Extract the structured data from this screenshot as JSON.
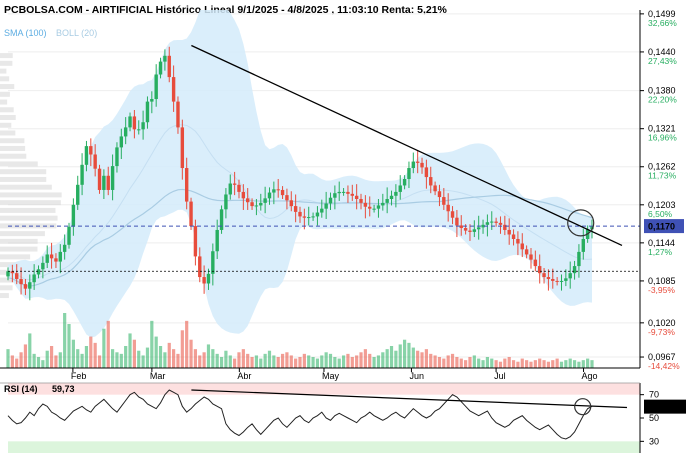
{
  "header": {
    "title": "PCBOLSA.COM - AIRTIFICIAL Histórico Lineal 9/1/2025 - 4/8/2025 , 11:03:10 Renta: 5,21%",
    "indicators": {
      "sma_label": "SMA (100)",
      "boll_label": "BOLL (20)"
    }
  },
  "colors": {
    "up": "#27ae60",
    "down": "#e74c3c",
    "bollinger_fill": "#d4ebfa",
    "sma": "#a9cce3",
    "current_price_line": "#3f51b5",
    "price_badge": "#3f51b5",
    "rsi_overbought_band": "#fde0e0",
    "rsi_oversold_band": "#dcf5dc"
  },
  "chart_data": {
    "type": "candlestick",
    "x_labels": [
      "Feb",
      "Mar",
      "Abr",
      "May",
      "Jun",
      "Jul",
      "Ago"
    ],
    "y_ticks": [
      "0,1499",
      "0,1440",
      "0,1380",
      "0,1321",
      "0,1262",
      "0,1203",
      "0,1144",
      "0,1085",
      "0,1020",
      "0,0967"
    ],
    "pct_ticks": [
      "32,66%",
      "27,43%",
      "22,20%",
      "16,96%",
      "11,73%",
      "6,50%",
      "1,27%",
      "-3,95%",
      "-9,73%",
      "-14,42%"
    ],
    "current_price": "0,1170",
    "reference_price": 0.11,
    "ylim": [
      0.095,
      0.1505
    ],
    "date_range": [
      "2025-01-09",
      "2025-08-04"
    ],
    "trendline": {
      "from": [
        "2025-03-15",
        0.145
      ],
      "to": [
        "2025-08-04",
        0.115
      ]
    },
    "highlight_circle_at": [
      "2025-07-31",
      0.1175
    ],
    "rsi": {
      "label": "RSI (14)",
      "value": "59,73",
      "value_badge": "59,736",
      "levels": [
        "70",
        "50",
        "30"
      ],
      "ylim": [
        20,
        80
      ],
      "trendline": {
        "from": [
          "2025-03-15",
          74
        ],
        "to": [
          "2025-08-04",
          60
        ]
      },
      "values": [
        52,
        48,
        45,
        46,
        50,
        55,
        52,
        58,
        62,
        60,
        55,
        53,
        50,
        48,
        52,
        56,
        58,
        60,
        57,
        55,
        60,
        63,
        66,
        62,
        58,
        55,
        60,
        65,
        70,
        72,
        68,
        66,
        62,
        60,
        58,
        63,
        70,
        74,
        72,
        70,
        60,
        55,
        58,
        62,
        65,
        68,
        66,
        62,
        60,
        58,
        45,
        40,
        37,
        35,
        38,
        42,
        45,
        40,
        36,
        40,
        44,
        48,
        50,
        45,
        42,
        46,
        50,
        52,
        48,
        46,
        50,
        52,
        55,
        50,
        48,
        52,
        54,
        52,
        50,
        48,
        46,
        50,
        52,
        55,
        52,
        50,
        48,
        50,
        53,
        55,
        52,
        50,
        54,
        58,
        55,
        52,
        50,
        52,
        56,
        58,
        62,
        66,
        70,
        68,
        64,
        60,
        56,
        54,
        52,
        54,
        56,
        50,
        46,
        44,
        42,
        44,
        48,
        50,
        52,
        48,
        45,
        42,
        40,
        42,
        44,
        40,
        36,
        33,
        32,
        34,
        38,
        45,
        52,
        58,
        60
      ]
    },
    "series": {
      "open": [
        0.1092,
        0.11,
        0.1097,
        0.1088,
        0.108,
        0.1073,
        0.1083,
        0.1095,
        0.1103,
        0.1113,
        0.1126,
        0.112,
        0.1115,
        0.113,
        0.1141,
        0.1169,
        0.1203,
        0.1234,
        0.1265,
        0.1294,
        0.1281,
        0.1259,
        0.1226,
        0.1248,
        0.1226,
        0.1263,
        0.1292,
        0.1309,
        0.1323,
        0.134,
        0.132,
        0.132,
        0.1331,
        0.1363,
        0.1367,
        0.1405,
        0.1425,
        0.1434,
        0.1401,
        0.1363,
        0.1323,
        0.126,
        0.1208,
        0.117,
        0.1123,
        0.1091,
        0.1081,
        0.1096,
        0.1131,
        0.1164,
        0.1196,
        0.1219,
        0.1236,
        0.1234,
        0.1223,
        0.1213,
        0.1207,
        0.1201,
        0.1202,
        0.1206,
        0.1213,
        0.1222,
        0.1227,
        0.1226,
        0.1218,
        0.121,
        0.1201,
        0.1192,
        0.1185,
        0.1183,
        0.1184,
        0.1185,
        0.1191,
        0.1197,
        0.1205,
        0.1214,
        0.1221,
        0.1223,
        0.1223,
        0.122,
        0.1217,
        0.1212,
        0.1206,
        0.12,
        0.1197,
        0.1197,
        0.1202,
        0.1206,
        0.1212,
        0.1217,
        0.1223,
        0.1233,
        0.1243,
        0.126,
        0.127,
        0.1268,
        0.1261,
        0.1246,
        0.1233,
        0.1224,
        0.1215,
        0.1203,
        0.1193,
        0.1183,
        0.1171,
        0.1167,
        0.1163,
        0.1161,
        0.1165,
        0.1168,
        0.1172,
        0.1176,
        0.1177,
        0.1175,
        0.1172,
        0.1164,
        0.1157,
        0.115,
        0.1143,
        0.1134,
        0.1126,
        0.1118,
        0.1108,
        0.1097,
        0.1091,
        0.1088,
        0.1085,
        0.1084,
        0.1085,
        0.1089,
        0.1097,
        0.1108,
        0.113,
        0.115,
        0.1165
      ],
      "close": [
        0.11,
        0.1097,
        0.1088,
        0.108,
        0.1073,
        0.1083,
        0.1095,
        0.1103,
        0.1113,
        0.1126,
        0.112,
        0.1115,
        0.113,
        0.1141,
        0.1169,
        0.1203,
        0.1234,
        0.1265,
        0.1294,
        0.1281,
        0.1259,
        0.1226,
        0.1248,
        0.1226,
        0.1263,
        0.1292,
        0.1309,
        0.1323,
        0.134,
        0.132,
        0.132,
        0.1331,
        0.1363,
        0.1367,
        0.1405,
        0.1425,
        0.1434,
        0.1401,
        0.1363,
        0.1323,
        0.126,
        0.1208,
        0.117,
        0.1123,
        0.1091,
        0.1081,
        0.1096,
        0.1131,
        0.1164,
        0.1196,
        0.1219,
        0.1236,
        0.1234,
        0.1223,
        0.1213,
        0.1207,
        0.1201,
        0.1202,
        0.1206,
        0.1213,
        0.1222,
        0.1227,
        0.1226,
        0.1218,
        0.121,
        0.1201,
        0.1192,
        0.1185,
        0.1183,
        0.1184,
        0.1185,
        0.1191,
        0.1197,
        0.1205,
        0.1214,
        0.1221,
        0.1223,
        0.1223,
        0.122,
        0.1217,
        0.1212,
        0.1206,
        0.12,
        0.1197,
        0.1197,
        0.1202,
        0.1206,
        0.1212,
        0.1217,
        0.1223,
        0.1233,
        0.1243,
        0.126,
        0.127,
        0.1268,
        0.1261,
        0.1246,
        0.1233,
        0.1224,
        0.1215,
        0.1203,
        0.1193,
        0.1183,
        0.1171,
        0.1167,
        0.1163,
        0.1161,
        0.1165,
        0.1168,
        0.1172,
        0.1176,
        0.1177,
        0.1175,
        0.1172,
        0.1164,
        0.1157,
        0.115,
        0.1143,
        0.1134,
        0.1126,
        0.1118,
        0.1108,
        0.1097,
        0.1091,
        0.1088,
        0.1085,
        0.1084,
        0.1085,
        0.1089,
        0.1097,
        0.1108,
        0.113,
        0.115,
        0.1165,
        0.117
      ],
      "volume": [
        12,
        8,
        6,
        10,
        15,
        22,
        9,
        7,
        5,
        11,
        14,
        8,
        10,
        35,
        28,
        18,
        12,
        9,
        14,
        20,
        16,
        8,
        25,
        30,
        12,
        10,
        9,
        14,
        22,
        18,
        11,
        8,
        13,
        30,
        20,
        14,
        10,
        16,
        12,
        9,
        24,
        30,
        18,
        12,
        8,
        10,
        15,
        12,
        9,
        7,
        11,
        8,
        6,
        10,
        12,
        9,
        7,
        8,
        6,
        9,
        11,
        8,
        7,
        9,
        10,
        8,
        6,
        7,
        9,
        8,
        7,
        6,
        8,
        10,
        9,
        7,
        6,
        8,
        9,
        7,
        8,
        10,
        12,
        9,
        7,
        8,
        10,
        12,
        14,
        11,
        15,
        18,
        16,
        13,
        11,
        10,
        12,
        9,
        8,
        7,
        6,
        8,
        9,
        7,
        6,
        5,
        7,
        8,
        6,
        5,
        7,
        6,
        5,
        4,
        6,
        7,
        5,
        4,
        6,
        5,
        4,
        5,
        6,
        5,
        4,
        5,
        6,
        4,
        5,
        6,
        5,
        4,
        5,
        6,
        5
      ]
    }
  }
}
